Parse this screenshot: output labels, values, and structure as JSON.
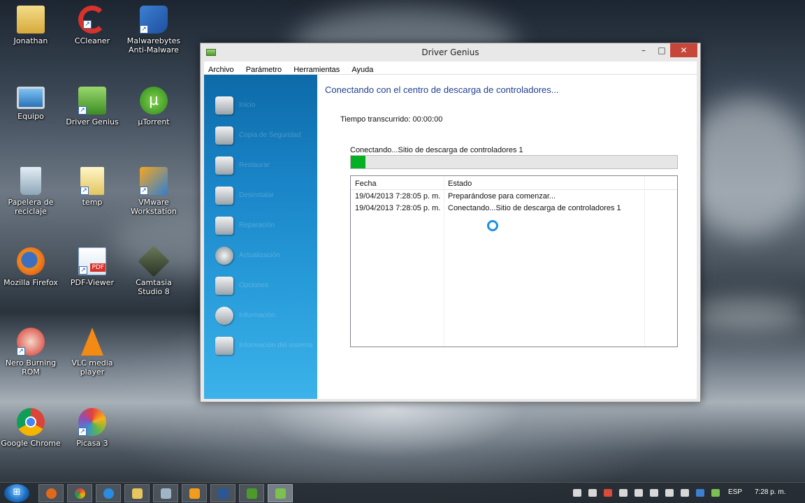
{
  "desktop": {
    "icons": [
      {
        "label": "Jonathan",
        "icon": "user-folder-icon"
      },
      {
        "label": "CCleaner",
        "icon": "ccleaner-icon"
      },
      {
        "label": "Malwarebytes Anti-Malware",
        "icon": "malwarebytes-icon"
      },
      {
        "label": "Equipo",
        "icon": "computer-icon"
      },
      {
        "label": "Driver Genius",
        "icon": "driver-genius-icon"
      },
      {
        "label": "µTorrent",
        "icon": "utorrent-icon"
      },
      {
        "label": "Papelera de reciclaje",
        "icon": "recycle-bin-icon"
      },
      {
        "label": "temp",
        "icon": "folder-icon"
      },
      {
        "label": "VMware Workstation",
        "icon": "vmware-icon"
      },
      {
        "label": "Mozilla Firefox",
        "icon": "firefox-icon"
      },
      {
        "label": "PDF-Viewer",
        "icon": "pdf-viewer-icon"
      },
      {
        "label": "Camtasia Studio 8",
        "icon": "camtasia-icon"
      },
      {
        "label": "Nero Burning ROM",
        "icon": "nero-icon"
      },
      {
        "label": "VLC media player",
        "icon": "vlc-icon"
      },
      {
        "label": "Google Chrome",
        "icon": "chrome-icon"
      },
      {
        "label": "Picasa 3",
        "icon": "picasa-icon"
      }
    ]
  },
  "window": {
    "title": "Driver Genius",
    "controls": {
      "minimize": "–",
      "maximize": "□",
      "close": "✕"
    },
    "menu": [
      "Archivo",
      "Parámetro",
      "Herramientas",
      "Ayuda"
    ],
    "sidebar": [
      {
        "label": "Inicio",
        "icon": "home-icon"
      },
      {
        "label": "Copia de Seguridad",
        "icon": "backup-icon"
      },
      {
        "label": "Restaurar",
        "icon": "restore-icon"
      },
      {
        "label": "Desinstalar",
        "icon": "uninstall-icon"
      },
      {
        "label": "Reparación",
        "icon": "repair-icon"
      },
      {
        "label": "Actualización",
        "icon": "download-icon"
      },
      {
        "label": "Opciones",
        "icon": "gears-icon"
      },
      {
        "label": "Información",
        "icon": "globe-icon"
      },
      {
        "label": "Información del sistema",
        "icon": "hardware-icon"
      }
    ],
    "content": {
      "heading": "Conectando con el centro de descarga de controladores...",
      "elapsed": "Tiempo transcurrido: 00:00:00",
      "progress_label": "Conectando...Sitio de descarga de controladores 1",
      "progress_fraction": 0.045,
      "log": {
        "columns": [
          "Fecha",
          "Estado"
        ],
        "rows": [
          {
            "fecha": "19/04/2013 7:28:05 p. m.",
            "estado": "Preparándose para comenzar..."
          },
          {
            "fecha": "19/04/2013 7:28:05 p. m.",
            "estado": "Conectando...Sitio de descarga de controladores 1"
          }
        ]
      }
    }
  },
  "taskbar": {
    "start_glyph": "⊞",
    "language": "ESP",
    "clock": "7:28 p. m."
  }
}
